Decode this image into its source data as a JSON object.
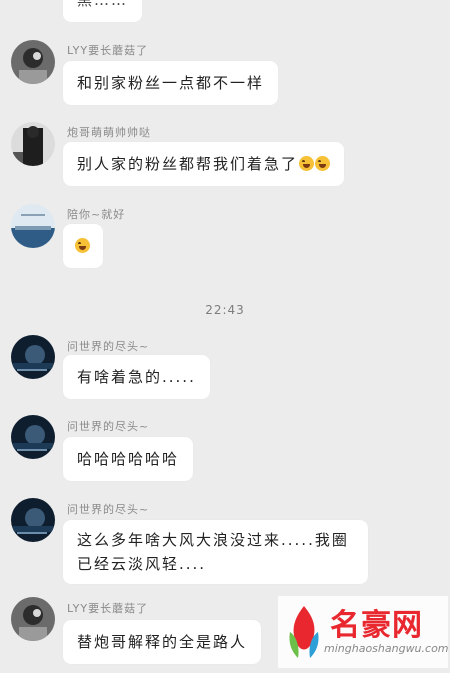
{
  "messages": [
    {
      "name": "",
      "text": "黑……"
    },
    {
      "name": "LYY要长蘑菇了",
      "text": "和别家粉丝一点都不一样"
    },
    {
      "name": "炮哥萌萌帅帅哒",
      "text": "别人家的粉丝都帮我们着急了"
    },
    {
      "name": "陪你~就好",
      "text": ""
    },
    {
      "name": "问世界的尽头~",
      "text": "有啥着急的....."
    },
    {
      "name": "问世界的尽头~",
      "text": "哈哈哈哈哈哈"
    },
    {
      "name": "问世界的尽头~",
      "text": "这么多年啥大风大浪没过来.....我圈已经云淡风轻...."
    },
    {
      "name": "LYY要长蘑菇了",
      "text": "替炮哥解释的全是路人"
    }
  ],
  "timestamp": "22:43",
  "watermark": {
    "title": "名豪网",
    "url": "minghaoshangwu.com"
  },
  "colors": {
    "background": "#ececec",
    "bubble": "#ffffff",
    "name": "#8a8a8a",
    "watermark": "#e8272f"
  }
}
